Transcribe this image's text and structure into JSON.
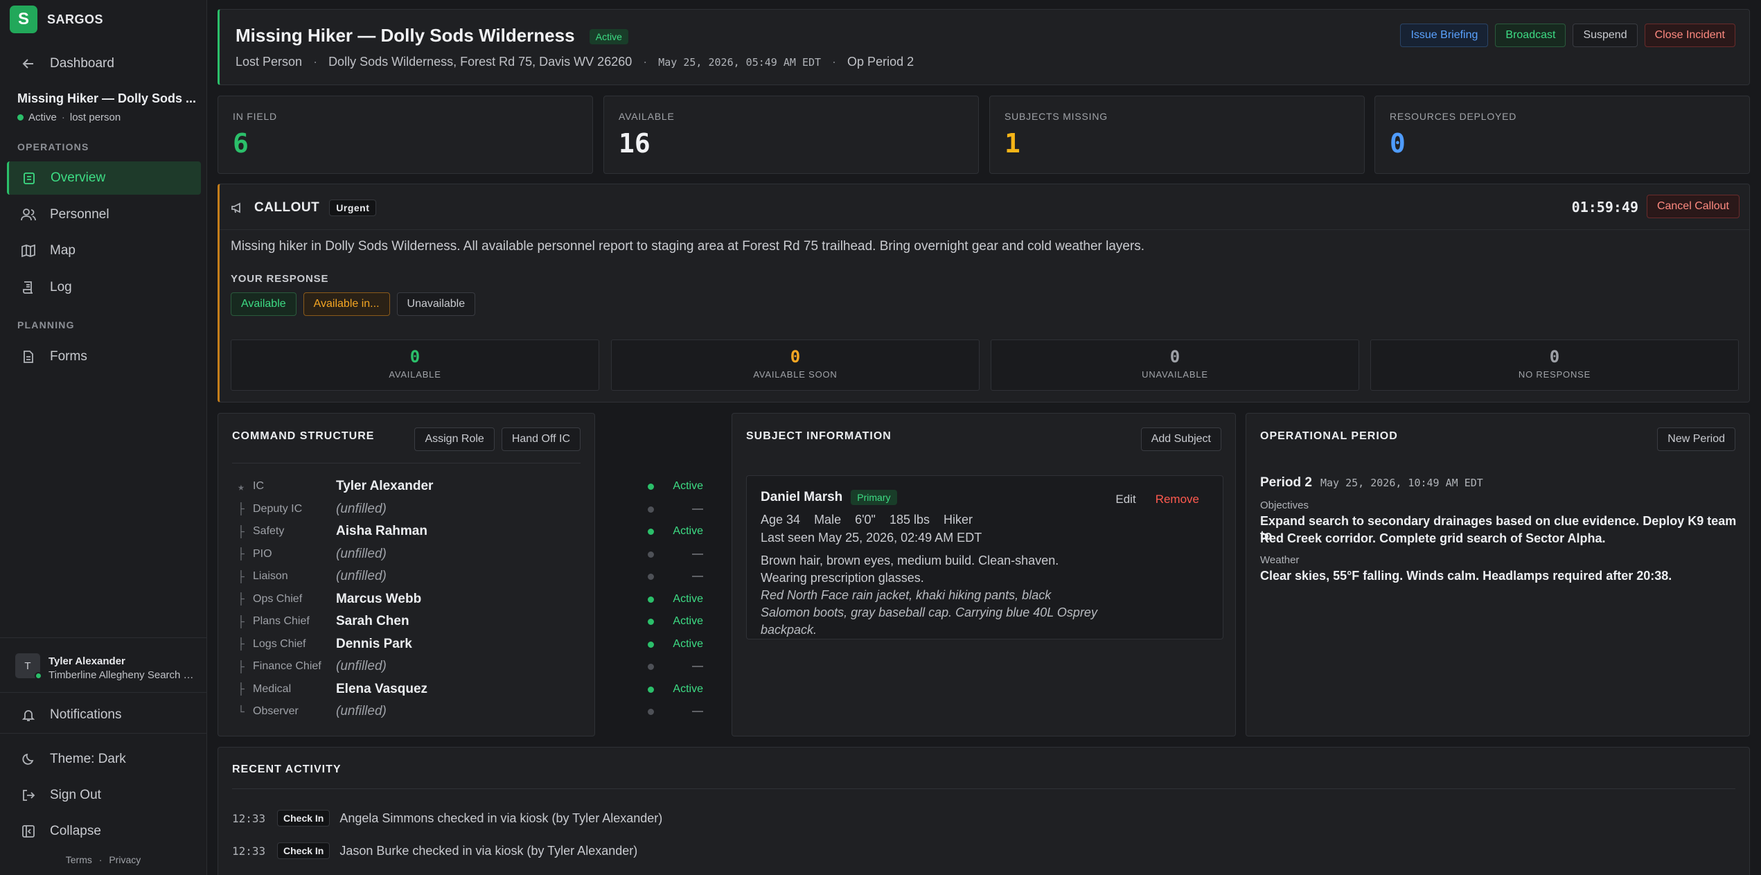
{
  "app": {
    "logo_letter": "S",
    "name": "SARGOS"
  },
  "sidebar": {
    "back_label": "Dashboard",
    "incident_name": "Missing Hiker — Dolly Sods ...",
    "incident_status": "Active",
    "incident_type": "lost person",
    "sections": {
      "operations": "OPERATIONS",
      "planning": "PLANNING"
    },
    "nav": {
      "overview": "Overview",
      "personnel": "Personnel",
      "map": "Map",
      "log": "Log",
      "forms": "Forms"
    },
    "user": {
      "initial": "T",
      "name": "Tyler Alexander",
      "org": "Timberline Allegheny Search and Rescue"
    },
    "notifications": "Notifications",
    "theme": "Theme: Dark",
    "sign_out": "Sign Out",
    "collapse": "Collapse",
    "terms": "Terms",
    "privacy": "Privacy"
  },
  "header": {
    "title": "Missing Hiker — Dolly Sods Wilderness",
    "status": "Active",
    "type": "Lost Person",
    "location": "Dolly Sods Wilderness, Forest Rd 75, Davis WV 26260",
    "datetime": "May 25, 2026, 05:49 AM EDT",
    "op_period": "Op Period 2",
    "actions": {
      "briefing": "Issue Briefing",
      "broadcast": "Broadcast",
      "suspend": "Suspend",
      "close": "Close Incident"
    }
  },
  "stats": {
    "in_field": {
      "label": "IN FIELD",
      "value": "6"
    },
    "available": {
      "label": "AVAILABLE",
      "value": "16"
    },
    "subjects_missing": {
      "label": "SUBJECTS MISSING",
      "value": "1"
    },
    "resources": {
      "label": "RESOURCES DEPLOYED",
      "value": "0"
    }
  },
  "callout": {
    "title": "CALLOUT",
    "priority": "Urgent",
    "timer": "01:59:49",
    "cancel": "Cancel Callout",
    "message": "Missing hiker in Dolly Sods Wilderness. All available personnel report to staging area at Forest Rd 75 trailhead. Bring overnight gear and cold weather layers.",
    "response_label": "YOUR RESPONSE",
    "responses": {
      "available": "Available",
      "available_in": "Available in...",
      "unavailable": "Unavailable"
    },
    "counts": {
      "available": {
        "value": "0",
        "label": "AVAILABLE"
      },
      "soon": {
        "value": "0",
        "label": "AVAILABLE SOON"
      },
      "unavailable": {
        "value": "0",
        "label": "UNAVAILABLE"
      },
      "none": {
        "value": "0",
        "label": "NO RESPONSE"
      }
    }
  },
  "command": {
    "title": "COMMAND STRUCTURE",
    "assign": "Assign Role",
    "handoff": "Hand Off IC",
    "rows": [
      {
        "glyph": "★",
        "role": "IC",
        "name": "Tyler Alexander",
        "status": "Active"
      },
      {
        "glyph": "├",
        "role": "Deputy IC",
        "name": "(unfilled)",
        "status": "—"
      },
      {
        "glyph": "├",
        "role": "Safety",
        "name": "Aisha Rahman",
        "status": "Active"
      },
      {
        "glyph": "├",
        "role": "PIO",
        "name": "(unfilled)",
        "status": "—"
      },
      {
        "glyph": "├",
        "role": "Liaison",
        "name": "(unfilled)",
        "status": "—"
      },
      {
        "glyph": "├",
        "role": "Ops Chief",
        "name": "Marcus Webb",
        "status": "Active"
      },
      {
        "glyph": "├",
        "role": "Plans Chief",
        "name": "Sarah Chen",
        "status": "Active"
      },
      {
        "glyph": "├",
        "role": "Logs Chief",
        "name": "Dennis Park",
        "status": "Active"
      },
      {
        "glyph": "├",
        "role": "Finance Chief",
        "name": "(unfilled)",
        "status": "—"
      },
      {
        "glyph": "├",
        "role": "Medical",
        "name": "Elena Vasquez",
        "status": "Active"
      },
      {
        "glyph": "└",
        "role": "Observer",
        "name": "(unfilled)",
        "status": "—"
      }
    ]
  },
  "subject": {
    "title": "SUBJECT INFORMATION",
    "add": "Add Subject",
    "name": "Daniel Marsh",
    "tag": "Primary",
    "edit": "Edit",
    "remove": "Remove",
    "age": "Age 34",
    "sex": "Male",
    "height": "6'0\"",
    "weight": "185 lbs",
    "category": "Hiker",
    "last_seen": "Last seen May 25, 2026, 02:49 AM EDT",
    "desc1": "Brown hair, brown eyes, medium build. Clean-shaven.",
    "desc2": "Wearing prescription glasses.",
    "clothing1": "Red North Face rain jacket, khaki hiking pants, black",
    "clothing2": "Salomon boots, gray baseball cap. Carrying blue 40L Osprey",
    "clothing3": "backpack."
  },
  "period": {
    "title": "OPERATIONAL PERIOD",
    "new": "New Period",
    "name": "Period 2",
    "datetime": "May 25, 2026, 10:49 AM EDT",
    "objectives_label": "Objectives",
    "objectives1": "Expand search to secondary drainages based on clue evidence. Deploy K9 team to",
    "objectives2": "Red Creek corridor. Complete grid search of Sector Alpha.",
    "weather_label": "Weather",
    "weather": "Clear skies, 55°F falling. Winds calm. Headlamps required after 20:38."
  },
  "activity": {
    "title": "RECENT ACTIVITY",
    "rows": [
      {
        "time": "12:33",
        "type": "Check In",
        "text": "Angela Simmons checked in via kiosk (by Tyler Alexander)"
      },
      {
        "time": "12:33",
        "type": "Check In",
        "text": "Jason Burke checked in via kiosk (by Tyler Alexander)"
      }
    ]
  },
  "colors": {
    "accent": "#2bbf6a",
    "callout": "#c47d1a",
    "stat_green": "#3ddc84",
    "stat_white": "#f1f2f4",
    "stat_orange": "#f5b417",
    "stat_blue": "#4f9cff"
  }
}
